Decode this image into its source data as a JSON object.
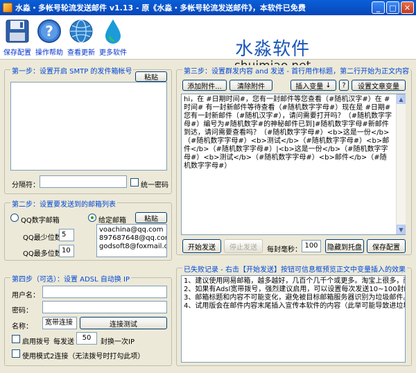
{
  "window": {
    "title": "水淼・多帐号轮流发送邮件 v1.13 - 原《水淼・多帐号轮流发送邮件》，本软件已免费"
  },
  "toolbar": {
    "save_config": "保存配置",
    "help": "操作帮助",
    "check_update": "查看更新",
    "more_software": "更多软件",
    "brand_cn": "水淼软件",
    "brand_en": "shuimiao.net"
  },
  "step1": {
    "title": "第一步：设置开启 SMTP 的发件箱帐号",
    "paste": "粘贴",
    "accounts": "",
    "separator_label": "分隔符：",
    "separator_value": "",
    "unified_password": "统一密码"
  },
  "step2": {
    "title": "第二步：设置要发送到的邮箱列表",
    "qq_number": "QQ数字邮箱",
    "given": "给定邮箱",
    "paste": "粘贴",
    "qq_min_label": "QQ最少位数：",
    "qq_min": "5",
    "qq_max_label": "QQ最多位数：",
    "qq_max": "10",
    "emails": "voachina@qq.com\n897687648@qq.com\ngodsoft8@foxmail.c"
  },
  "step3": {
    "title": "第三步：设置群发内容 and 发送 - 首行用作标题，第二行开始为正文内容",
    "add_attachment": "添加附件...",
    "clear_attachment": "清除附件",
    "insert_variable": "插入变量",
    "question": "?",
    "set_variable": "设置文章变量",
    "content": "hi，在 #日期时间#，您有一封邮件等您查看（#随机汉字#）在 #时间# 有一封新邮件等待查看（#随机数字字母#）现在是 #日期# 您有一封新邮件（#随机汉字#），请问需要打开吗？（#随机数字字母#）编号为#随机数字#的神秘邮件已到]#随机数字字母#新邮件到达，请问需要查看吗？（#随机数字字母#）<b>这是一份</b>（#随机数字字母#）<b>测试</b>（#随机数字字母#）<b>邮件</b>（#随机数字字母#）|<b>这是一份</b>（#随机数字字母#）<b>测试</b>（#随机数字字母#）<b>邮件</b>（#随机数字字母#）",
    "start": "开始发送",
    "stop": "停止发送",
    "interval_label": "每封毫秒：",
    "interval": "100",
    "hide_tray": "隐藏到托盘",
    "save_config": "保存配置"
  },
  "log": {
    "title": "已失败记录 - 右击【开始发送】按钮可信息框预览正文中变量插入的效果",
    "lines": "1、建议使用网易邮箱，越多越好，几百个几千个或更多。淘宝上很多，而且很便宜\n2、如果有Adsl宽带拨号，强烈建议启用，可以设置每次发送10~100封邮件就换一\n3、邮箱标题和内容不可能变化，避免被目标邮箱服务器识别为垃圾邮件。\n4、试用版会在邮件内容末尾插入宣传本软件的内容（此举可能导致进垃圾箱几率"
  },
  "step4": {
    "title": "第四步（可选）：设置 ADSL 自动换 IP",
    "username_label": "用户名：",
    "username": "",
    "password_label": "密码：",
    "password": "",
    "name_label": "名称：",
    "name_value": "宽带连接",
    "test_connection": "连接测试",
    "enable_dial": "启用拨号",
    "every_send": "每发送",
    "every_count": "50",
    "switch_ip": "封换一次IP",
    "mode2": "使用模式2连接（无法拨号时打勾此项）"
  }
}
